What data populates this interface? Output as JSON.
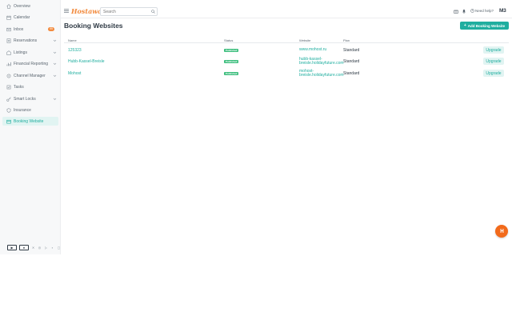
{
  "app": {
    "logo": "Hostaway"
  },
  "search": {
    "placeholder": "Search"
  },
  "topbar": {
    "help_label": "Need help?",
    "avatar_initials": "M3"
  },
  "sidebar": {
    "items": [
      {
        "label": "Overview",
        "icon": "home-icon"
      },
      {
        "label": "Calendar",
        "icon": "calendar-icon"
      },
      {
        "label": "Inbox",
        "icon": "inbox-icon",
        "badge": "99"
      },
      {
        "label": "Reservations",
        "icon": "reservations-icon"
      },
      {
        "label": "Listings",
        "icon": "listings-icon"
      },
      {
        "label": "Financial Reporting",
        "icon": "chart-icon"
      },
      {
        "label": "Channel Manager",
        "icon": "channel-icon"
      },
      {
        "label": "Tasks",
        "icon": "tasks-icon"
      },
      {
        "label": "Smart Locks",
        "icon": "key-icon"
      },
      {
        "label": "Insurance",
        "icon": "shield-icon"
      },
      {
        "label": "Booking Website",
        "icon": "website-icon"
      }
    ],
    "active": "Booking Website"
  },
  "main": {
    "title": "Booking Websites",
    "add_button_label": "Add Booking Website",
    "columns": [
      "Name",
      "Status",
      "Website",
      "Plan"
    ],
    "rows": [
      {
        "name": "125323",
        "status": "Published",
        "website": "www.mohost.ru",
        "plan": "Standard",
        "action": "Upgrade"
      },
      {
        "name": "Hubb-Kassel-Breisle",
        "status": "Published",
        "website": "hubb-kassel-breisle.holidayfuture.com",
        "plan": "Standard",
        "action": "Upgrade"
      },
      {
        "name": "Mohost",
        "status": "Published",
        "website": "mohost-breisle.holidayfuture.com",
        "plan": "Standard",
        "action": "Upgrade"
      }
    ]
  },
  "colors": {
    "accent": "#1fae9f",
    "brand": "#f28a3d",
    "published": "#3fbf7f",
    "fab": "#f26a1b"
  }
}
